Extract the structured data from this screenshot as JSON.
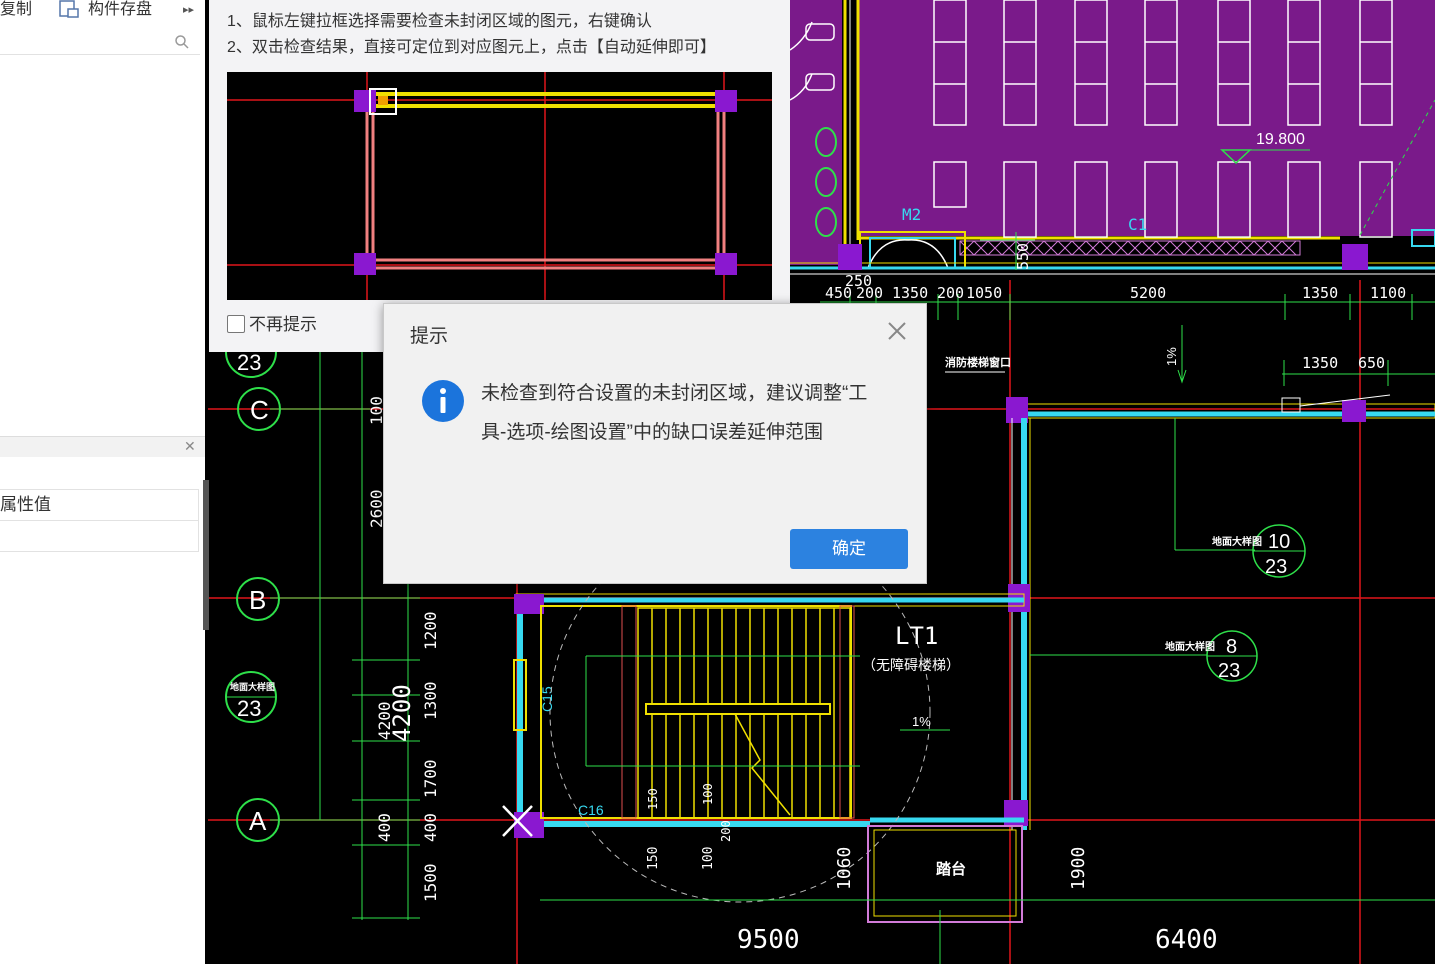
{
  "left_panel": {
    "copy_label": "复制",
    "save_component_label": "构件存盘",
    "property_value_header": "属性值"
  },
  "help_panel": {
    "line1": "1、鼠标左键拉框选择需要检查未封闭区域的图元，右键确认",
    "line2": "2、双击检查结果，直接可定位到对应图元上，点击【自动延伸即可】",
    "dont_show_again": "不再提示"
  },
  "dialog": {
    "title": "提示",
    "message": "未检查到符合设置的未封闭区域，建议调整“工具-选项-绘图设置”中的缺口误差延伸范围",
    "ok_label": "确定"
  },
  "cad": {
    "top_dims": [
      "450",
      "200",
      "1350",
      "200",
      "1050",
      "5200",
      "1350",
      "1100"
    ],
    "dim_250": "250",
    "dim_550": "550",
    "dims_1350_650": [
      "1350",
      "650"
    ],
    "left_dims": [
      "100",
      "2600",
      "1200",
      "1300",
      "1700",
      "400",
      "1500"
    ],
    "dim_4200_a": "4200",
    "dim_4200_b": "4200",
    "bottom_dims": [
      "9500",
      "6400"
    ],
    "stair_dims": [
      "150",
      "100",
      "1060"
    ],
    "stair_dims_rot": [
      "150",
      "100",
      "200"
    ],
    "dim_1900": "1900",
    "level": "19.800",
    "axis_c": "C",
    "axis_b": "B",
    "axis_a": "A",
    "ref_23_top": "23",
    "ref_23_mid": "23",
    "ref_10": [
      "10",
      "23"
    ],
    "ref_8": [
      "8",
      "23"
    ],
    "lt1": "LT1",
    "lt1_sub": "（无障碍楼梯）",
    "m2": "M2",
    "c1": "C1",
    "c15": "C15",
    "c16": "C16",
    "slope": "1%",
    "slope2": "1%",
    "platform": "踏台",
    "note_small1": "消防楼梯窗口",
    "note_small2": "地面大样图",
    "note_small3": "地面大样图",
    "note_small4": "地面大样图"
  },
  "colors": {
    "purple": "#7a1a8a",
    "dialog_button": "#2c82e0",
    "info_icon": "#1b74dc"
  }
}
